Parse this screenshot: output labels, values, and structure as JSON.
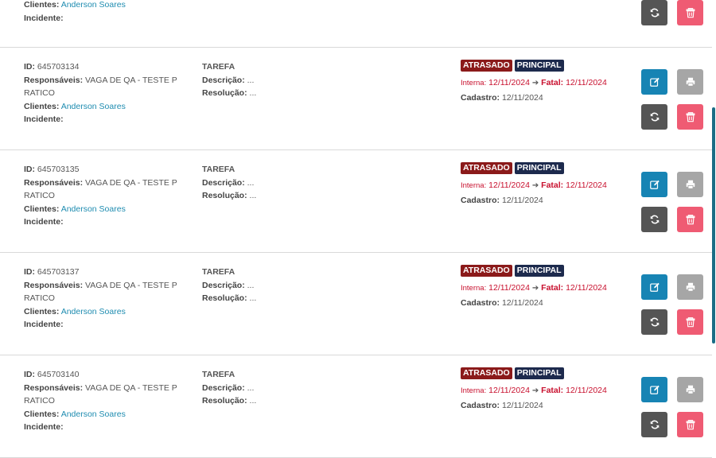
{
  "labels": {
    "id": "ID:",
    "responsaveis": "Responsáveis:",
    "clientes": "Clientes:",
    "incidente": "Incidente:",
    "descricao": "Descrição:",
    "resolucao": "Resolução:",
    "interna": "Interna:",
    "fatal": "Fatal:",
    "cadastro": "Cadastro:"
  },
  "partial_row": {
    "cliente": "Anderson Soares",
    "incidente": ""
  },
  "rows": [
    {
      "id": "645703134",
      "responsaveis_line1": "VAGA DE QA - TESTE P",
      "responsaveis_line2": "RATICO",
      "cliente": "Anderson Soares",
      "incidente": "",
      "tipo": "TAREFA",
      "descricao": "...",
      "resolucao": "...",
      "badges": [
        "ATRASADO",
        "PRINCIPAL"
      ],
      "interna": "12/11/2024",
      "fatal": "12/11/2024",
      "cadastro": "12/11/2024"
    },
    {
      "id": "645703135",
      "responsaveis_line1": "VAGA DE QA - TESTE P",
      "responsaveis_line2": "RATICO",
      "cliente": "Anderson Soares",
      "incidente": "",
      "tipo": "TAREFA",
      "descricao": "...",
      "resolucao": "...",
      "badges": [
        "ATRASADO",
        "PRINCIPAL"
      ],
      "interna": "12/11/2024",
      "fatal": "12/11/2024",
      "cadastro": "12/11/2024"
    },
    {
      "id": "645703137",
      "responsaveis_line1": "VAGA DE QA - TESTE P",
      "responsaveis_line2": "RATICO",
      "cliente": "Anderson Soares",
      "incidente": "",
      "tipo": "TAREFA",
      "descricao": "...",
      "resolucao": "...",
      "badges": [
        "ATRASADO",
        "PRINCIPAL"
      ],
      "interna": "12/11/2024",
      "fatal": "12/11/2024",
      "cadastro": "12/11/2024"
    },
    {
      "id": "645703140",
      "responsaveis_line1": "VAGA DE QA - TESTE P",
      "responsaveis_line2": "RATICO",
      "cliente": "Anderson Soares",
      "incidente": "",
      "tipo": "TAREFA",
      "descricao": "...",
      "resolucao": "...",
      "badges": [
        "ATRASADO",
        "PRINCIPAL"
      ],
      "interna": "12/11/2024",
      "fatal": "12/11/2024",
      "cadastro": "12/11/2024"
    }
  ],
  "icons": {
    "edit": "edit-icon",
    "print": "print-icon",
    "sync": "sync-icon",
    "delete": "trash-icon"
  },
  "colors": {
    "late_badge": "#8b1a1a",
    "principal_badge": "#1d2a4d",
    "edit_button": "#1784b4",
    "print_button": "#a6a6a6",
    "sync_button": "#555555",
    "delete_button": "#ef5b73",
    "link": "#1e8cb0",
    "deadline_red": "#c8102e"
  }
}
